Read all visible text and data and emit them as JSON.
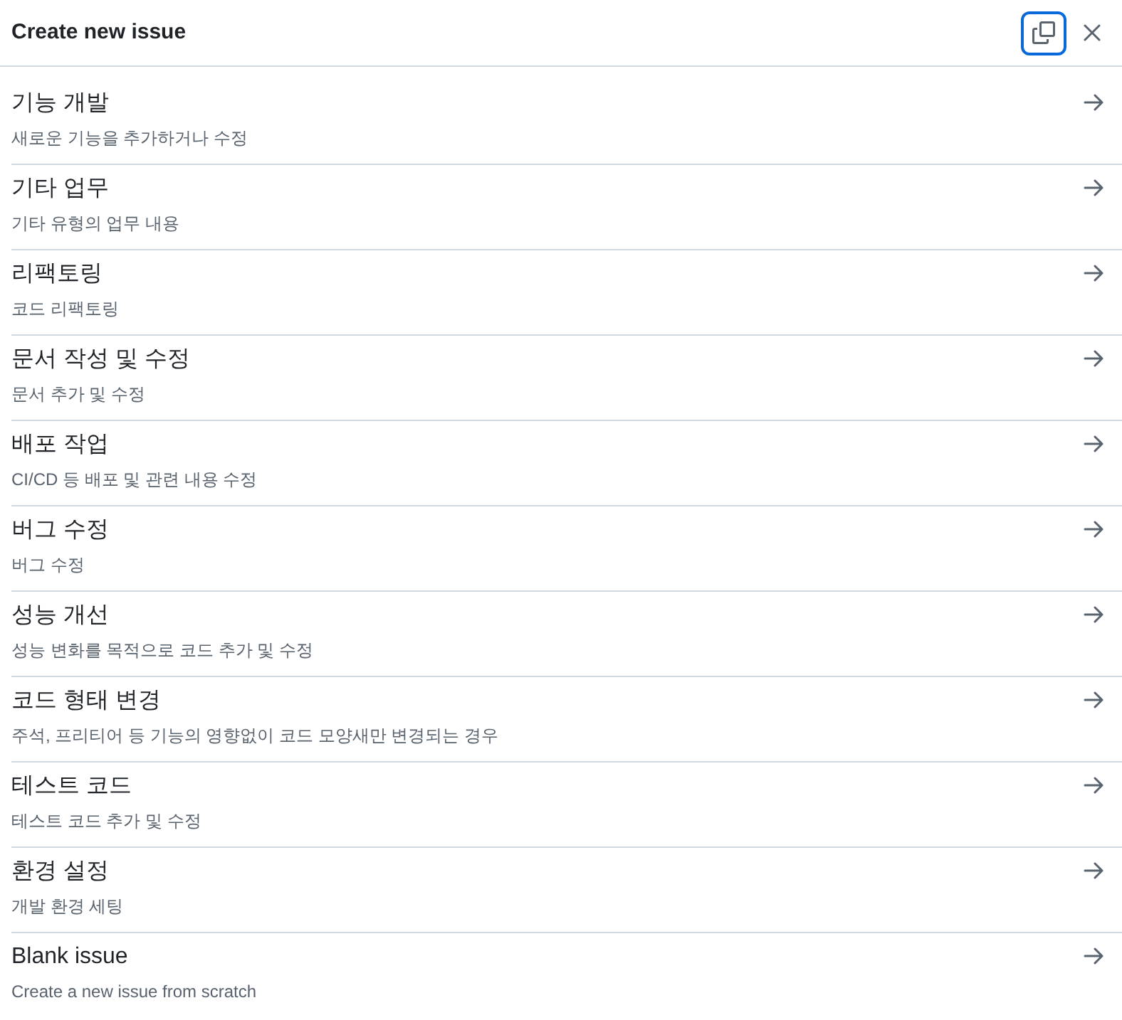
{
  "dialog": {
    "title": "Create new issue",
    "copy_button": {
      "focused": true
    }
  },
  "templates": [
    {
      "title": "기능 개발",
      "description": "새로운 기능을 추가하거나 수정"
    },
    {
      "title": "기타 업무",
      "description": "기타 유형의 업무 내용"
    },
    {
      "title": "리팩토링",
      "description": "코드 리팩토링"
    },
    {
      "title": "문서 작성 및 수정",
      "description": "문서 추가 및 수정"
    },
    {
      "title": "배포 작업",
      "description": "CI/CD 등 배포 및 관련 내용 수정"
    },
    {
      "title": "버그 수정",
      "description": "버그 수정"
    },
    {
      "title": "성능 개선",
      "description": "성능 변화를 목적으로 코드 추가 및 수정"
    },
    {
      "title": "코드 형태 변경",
      "description": "주석, 프리티어 등 기능의 영향없이 코드 모양새만 변경되는 경우"
    },
    {
      "title": "테스트 코드",
      "description": "테스트 코드 추가 및 수정"
    },
    {
      "title": "환경 설정",
      "description": "개발 환경 세팅"
    },
    {
      "title": "Blank issue",
      "description": "Create a new issue from scratch"
    }
  ]
}
